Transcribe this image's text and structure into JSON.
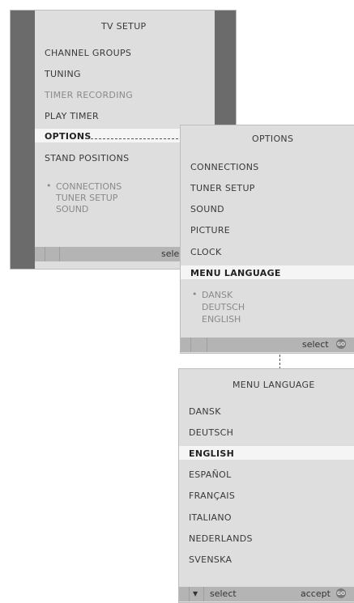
{
  "tv_setup": {
    "title": "TV SETUP",
    "items": [
      "CHANNEL GROUPS",
      "TUNING",
      "TIMER RECORDING",
      "PLAY TIMER",
      "OPTIONS",
      "STAND POSITIONS"
    ],
    "submenu": [
      "CONNECTIONS",
      "TUNER SETUP",
      "SOUND"
    ],
    "footer_select": "select"
  },
  "options": {
    "title": "OPTIONS",
    "items": [
      "CONNECTIONS",
      "TUNER SETUP",
      "SOUND",
      "PICTURE",
      "CLOCK",
      "MENU LANGUAGE"
    ],
    "submenu": [
      "DANSK",
      "DEUTSCH",
      "ENGLISH"
    ],
    "footer_select": "select",
    "go_icon": "GO"
  },
  "menu_language": {
    "title": "MENU LANGUAGE",
    "items": [
      "DANSK",
      "DEUTSCH",
      "ENGLISH",
      "ESPAÑOL",
      "FRANÇAIS",
      "ITALIANO",
      "NEDERLANDS",
      "SVENSKA"
    ],
    "footer_select": "select",
    "footer_accept": "accept",
    "go_icon": "GO"
  },
  "colors": {
    "panel": "#dedede",
    "sidebar": "#6b6b6b",
    "highlight": "#f5f5f5",
    "footer": "#b4b4b4"
  }
}
